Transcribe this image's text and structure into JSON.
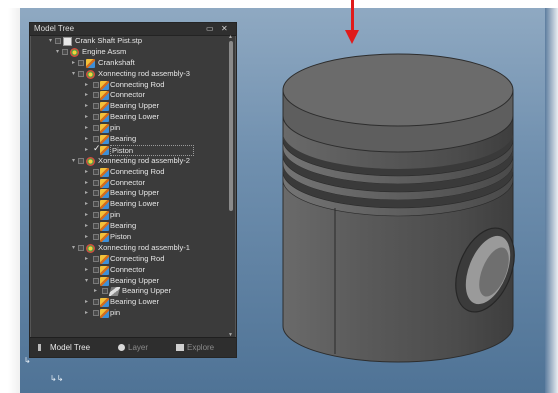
{
  "panel": {
    "title": "Model Tree",
    "tabs": [
      {
        "label": "Model Tree",
        "active": true
      },
      {
        "label": "Layer",
        "active": false
      },
      {
        "label": "Explore",
        "active": false
      }
    ]
  },
  "tree": [
    {
      "label": "Crank Shaft Pist.stp",
      "level": 0,
      "expanded": true,
      "icon": "document-icon"
    },
    {
      "label": "Engine Assm",
      "level": 1,
      "expanded": true,
      "icon": "assembly-icon"
    },
    {
      "label": "Crankshaft",
      "level": 2,
      "expanded": false,
      "icon": "part-icon"
    },
    {
      "label": "Xonnecting rod assembly-3",
      "level": 2,
      "expanded": true,
      "icon": "assembly-icon"
    },
    {
      "label": "Connecting Rod",
      "level": 3,
      "expanded": false,
      "icon": "part-icon"
    },
    {
      "label": "Connector",
      "level": 3,
      "expanded": false,
      "icon": "part-icon"
    },
    {
      "label": "Bearing Upper",
      "level": 3,
      "expanded": false,
      "icon": "part-icon"
    },
    {
      "label": "Bearing Lower",
      "level": 3,
      "expanded": false,
      "icon": "part-icon"
    },
    {
      "label": "pin",
      "level": 3,
      "expanded": false,
      "icon": "part-icon"
    },
    {
      "label": "Bearing",
      "level": 3,
      "expanded": false,
      "icon": "part-icon"
    },
    {
      "label": "Piston",
      "level": 3,
      "expanded": false,
      "icon": "part-icon",
      "checked": true,
      "selected": true
    },
    {
      "label": "Xonnecting rod assembly-2",
      "level": 2,
      "expanded": true,
      "icon": "assembly-icon"
    },
    {
      "label": "Connecting Rod",
      "level": 3,
      "expanded": false,
      "icon": "part-icon"
    },
    {
      "label": "Connector",
      "level": 3,
      "expanded": false,
      "icon": "part-icon"
    },
    {
      "label": "Bearing Upper",
      "level": 3,
      "expanded": false,
      "icon": "part-icon"
    },
    {
      "label": "Bearing Lower",
      "level": 3,
      "expanded": false,
      "icon": "part-icon"
    },
    {
      "label": "pin",
      "level": 3,
      "expanded": false,
      "icon": "part-icon"
    },
    {
      "label": "Bearing",
      "level": 3,
      "expanded": false,
      "icon": "part-icon"
    },
    {
      "label": "Piston",
      "level": 3,
      "expanded": false,
      "icon": "part-icon"
    },
    {
      "label": "Xonnecting rod assembly-1",
      "level": 2,
      "expanded": true,
      "icon": "assembly-icon"
    },
    {
      "label": "Connecting Rod",
      "level": 3,
      "expanded": false,
      "icon": "part-icon"
    },
    {
      "label": "Connector",
      "level": 3,
      "expanded": false,
      "icon": "part-icon"
    },
    {
      "label": "Bearing Upper",
      "level": 3,
      "expanded": true,
      "icon": "part-icon"
    },
    {
      "label": "Bearing Upper",
      "level": 4,
      "expanded": false,
      "icon": "body-icon"
    },
    {
      "label": "Bearing Lower",
      "level": 3,
      "expanded": false,
      "icon": "part-icon"
    },
    {
      "label": "pin",
      "level": 3,
      "expanded": false,
      "icon": "part-icon"
    }
  ],
  "colors": {
    "panel_bg": "#3b3b3b",
    "viewport_top": "#8fa9c2",
    "viewport_bottom": "#4f7396",
    "piston": "#606060",
    "indicator_arrow": "#e01b1b"
  }
}
